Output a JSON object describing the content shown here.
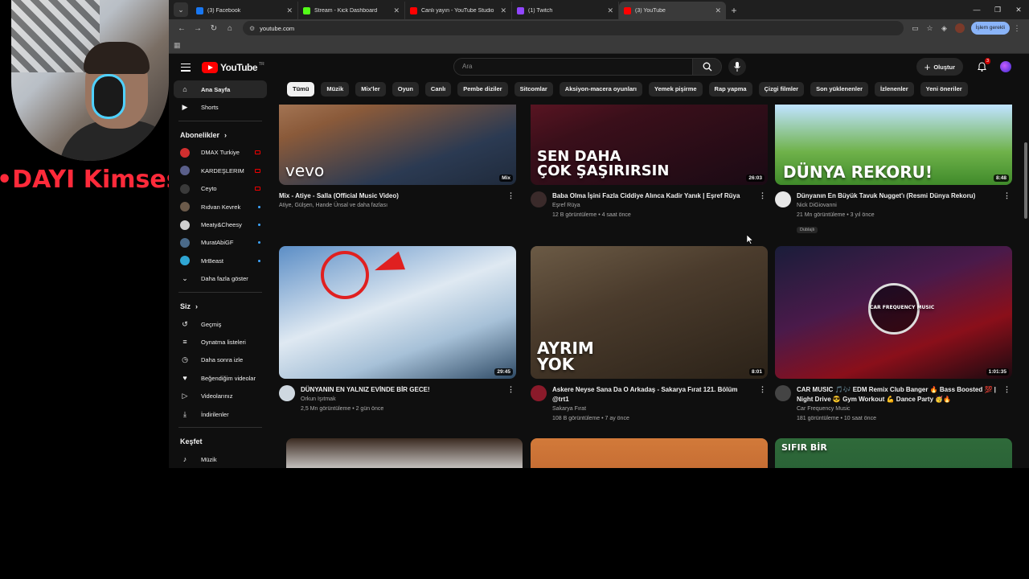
{
  "overlay": {
    "ticker": "•DAYI     Kimsesiz"
  },
  "tabs": [
    {
      "label": "(3) Facebook",
      "color": "#1877f2",
      "active": false
    },
    {
      "label": "Stream - Kick Dashboard",
      "color": "#53fc18",
      "active": false
    },
    {
      "label": "Canlı yayın - YouTube Studio",
      "color": "#ff0000",
      "active": false
    },
    {
      "label": "(1) Twitch",
      "color": "#9146ff",
      "active": false
    },
    {
      "label": "(3) YouTube",
      "color": "#ff0000",
      "active": true
    }
  ],
  "address": {
    "url": "youtube.com",
    "update_label": "İşlem gerekli"
  },
  "youtube": {
    "logo_text": "YouTube",
    "logo_region": "TR",
    "search_placeholder": "Ara",
    "create_label": "Oluştur",
    "notif_count": "3",
    "sidebar": {
      "main": [
        {
          "label": "Ana Sayfa",
          "icon": "home-icon",
          "glyph": "⌂",
          "active": true
        },
        {
          "label": "Shorts",
          "icon": "shorts-icon",
          "glyph": "▶",
          "active": false
        }
      ],
      "subs_header": "Abonelikler",
      "subs": [
        {
          "label": "DMAX Turkiye",
          "color": "#d12f2f",
          "status": "live"
        },
        {
          "label": "KARDEŞLERIM",
          "color": "#5a5f8a",
          "status": "live"
        },
        {
          "label": "Ceyto",
          "color": "#3a3a3a",
          "status": "live"
        },
        {
          "label": "Rıdvan Kevrek",
          "color": "#6b5a4a",
          "status": "new"
        },
        {
          "label": "Meaty&Cheesy",
          "color": "#cfcfcf",
          "status": "new"
        },
        {
          "label": "MuratAbiGF",
          "color": "#4a6a8a",
          "status": "new"
        },
        {
          "label": "MrBeast",
          "color": "#2fa6d4",
          "status": "new"
        }
      ],
      "show_more": "Daha fazla göster",
      "you_header": "Siz",
      "you": [
        {
          "label": "Geçmiş",
          "glyph": "↺",
          "icon": "history-icon"
        },
        {
          "label": "Oynatma listeleri",
          "glyph": "≡",
          "icon": "playlists-icon"
        },
        {
          "label": "Daha sonra izle",
          "glyph": "◷",
          "icon": "watch-later-icon"
        },
        {
          "label": "Beğendiğim videolar",
          "glyph": "♥",
          "icon": "liked-icon"
        },
        {
          "label": "Videolarınız",
          "glyph": "▷",
          "icon": "your-videos-icon"
        },
        {
          "label": "İndirilenler",
          "glyph": "⤓",
          "icon": "downloads-icon"
        }
      ],
      "explore_header": "Keşfet",
      "explore": [
        {
          "label": "Müzik",
          "glyph": "♪",
          "icon": "music-icon"
        }
      ]
    },
    "chips": [
      "Tümü",
      "Müzik",
      "Mix'ler",
      "Oyun",
      "Canlı",
      "Pembe diziler",
      "Sitcomlar",
      "Aksiyon-macera oyunları",
      "Yemek pişirme",
      "Rap yapma",
      "Çizgi filmler",
      "Son yüklenenler",
      "İzlenenler",
      "Yeni öneriler"
    ],
    "videos": [
      {
        "title": "Mix - Atiye - Salla (Official Music Video)",
        "channel": "Atiye, Gülşen, Hande Ünsal ve daha fazlası",
        "stats": "",
        "duration": "Mix",
        "thumb_text": "vevo",
        "avatar": ""
      },
      {
        "title": "Baba Olma İşini Fazla Ciddiye Alınca Kadir Yanık | Eşref Rüya",
        "channel": "Eşref Rüya",
        "stats": "12 B görüntüleme • 4 saat önce",
        "duration": "26:03",
        "thumb_text": "SEN DAHA\nÇOK ŞAŞIRIRSIN",
        "avatar": "#3a2a2a"
      },
      {
        "title": "Dünyanın En Büyük Tavuk Nugget'ı (Resmi Dünya Rekoru)",
        "channel": "Nick DiGiovanni",
        "stats": "21 Mn görüntüleme • 3 yıl önce",
        "duration": "8:48",
        "thumb_text": "DÜNYA REKORU!",
        "avatar": "#e8e8e8",
        "badge": "Dublajlı"
      },
      {
        "title": "DÜNYANIN EN YALNIZ EVİNDE BİR GECE!",
        "channel": "Orkun Işıtmak",
        "stats": "2,5 Mn görüntüleme • 2 gün önce",
        "duration": "29:45",
        "thumb_text": "",
        "avatar": "#cfd8e0"
      },
      {
        "title": "Askere Neyse Sana Da O Arkadaş - Sakarya Fırat 121. Bölüm @trt1",
        "channel": "Sakarya Fırat",
        "stats": "108 B görüntüleme • 7 ay önce",
        "duration": "8:01",
        "thumb_text": "AYRIM\nYOK",
        "avatar": "#8a1a2a"
      },
      {
        "title": "CAR MUSIC 🎵🎶 EDM Remix Club Banger 🔥 Bass Boosted 💯 | Night Drive 😎 Gym Workout 💪 Dance Party 🥳🔥",
        "channel": "Car Frequency Music",
        "stats": "181 görüntüleme • 10 saat önce",
        "duration": "1:01:35",
        "thumb_text": "CAR FREQUENCY MUSIC",
        "avatar": "#444"
      }
    ],
    "row3_text": "SIFIR BİR"
  }
}
